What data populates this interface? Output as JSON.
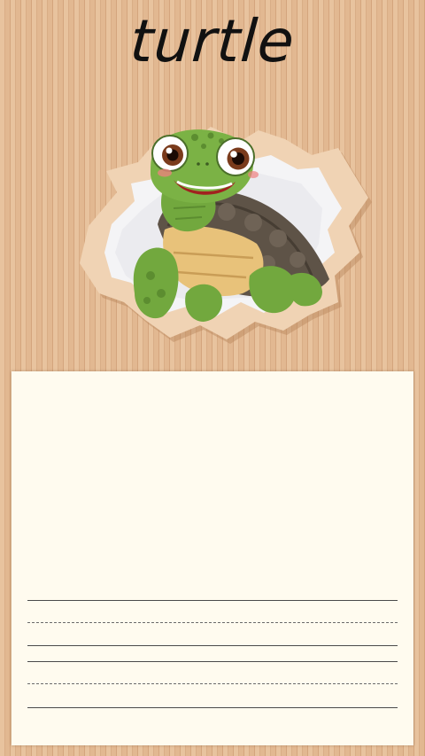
{
  "worksheet": {
    "title": "turtle",
    "illustration_icon": "cartoon-turtle-through-torn-paper-icon",
    "writing_line_sets": 2,
    "colors": {
      "background": "#e4bd96",
      "card": "#fffbef",
      "turtle_skin": "#72a83e",
      "turtle_shell": "#5e5347"
    }
  }
}
